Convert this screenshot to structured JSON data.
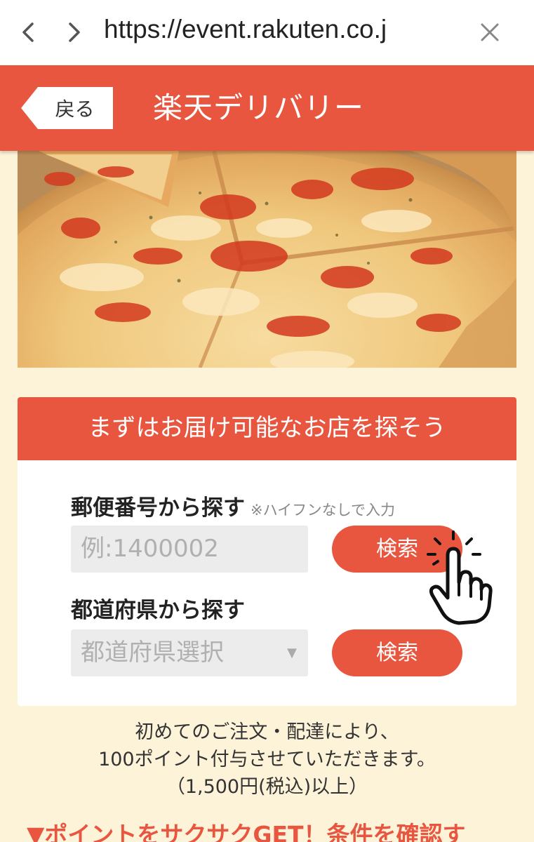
{
  "browser": {
    "url": "https://event.rakuten.co.j"
  },
  "header": {
    "back_label": "戻る",
    "title": "楽天デリバリー"
  },
  "search_panel": {
    "heading": "まずはお届け可能なお店を探そう",
    "postal": {
      "label": "郵便番号から探す",
      "note": "※ハイフンなしで入力",
      "placeholder": "例:1400002",
      "button": "検索"
    },
    "prefecture": {
      "label": "都道府県から探す",
      "selected": "都道府県選択",
      "button": "検索"
    }
  },
  "info": {
    "line1": "初めてのご注文・配達により、",
    "line2": "100ポイント付与させていただきます。",
    "line3": "（1,500円(税込)以上）"
  },
  "promo": "▼ポイントをサクサクGET！条件を確認す",
  "colors": {
    "brand": "#e85640",
    "page_bg": "#fdf3d9"
  }
}
